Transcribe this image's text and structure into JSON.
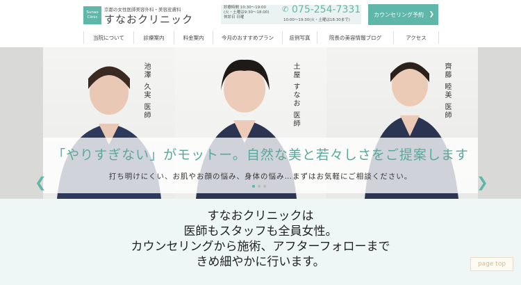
{
  "header": {
    "logo_text": "Sunao Clinic",
    "tagline": "京都の女性医師美容外科・美容皮膚科",
    "clinic_name": "すなおクリニック",
    "hours_lines": [
      "診療時間 10:30～19:00",
      "(火・土曜は9:30～18:00)",
      "休診日 日曜"
    ],
    "phone": "075-254-7331",
    "phone_hours": "10:00～19:30(火・土曜は18:30まで)",
    "cta_label": "カウンセリング予約",
    "cta_arrow": "❯"
  },
  "nav": [
    "当院について",
    "診療案内",
    "料金案内",
    "今月のおすすめプラン",
    "症例写真",
    "院長の美容情報ブログ",
    "アクセス"
  ],
  "hero": {
    "doctors": [
      {
        "name": "池澤 久実 医師"
      },
      {
        "name": "土屋 すなお 医師"
      },
      {
        "name": "齊藤 睦美 医師"
      }
    ],
    "slogan": "「やりすぎない」がモットー。自然な美と若々しさをご提案します",
    "sub_slogan": "打ち明けにくい、お肌やお顔の悩み、身体の悩み…まずはお気軽にご相談ください。",
    "prev_arrow": "❮",
    "next_arrow": "❯"
  },
  "intro": {
    "lines": [
      "すなおクリニックは",
      "医師もスタッフも全員女性。",
      "カウンセリングから施術、アフターフォローまで",
      "きめ細やかに行います。"
    ]
  },
  "page_top": "page top",
  "colors": {
    "accent": "#5fb7a9",
    "light_bg": "#eef7f5"
  }
}
